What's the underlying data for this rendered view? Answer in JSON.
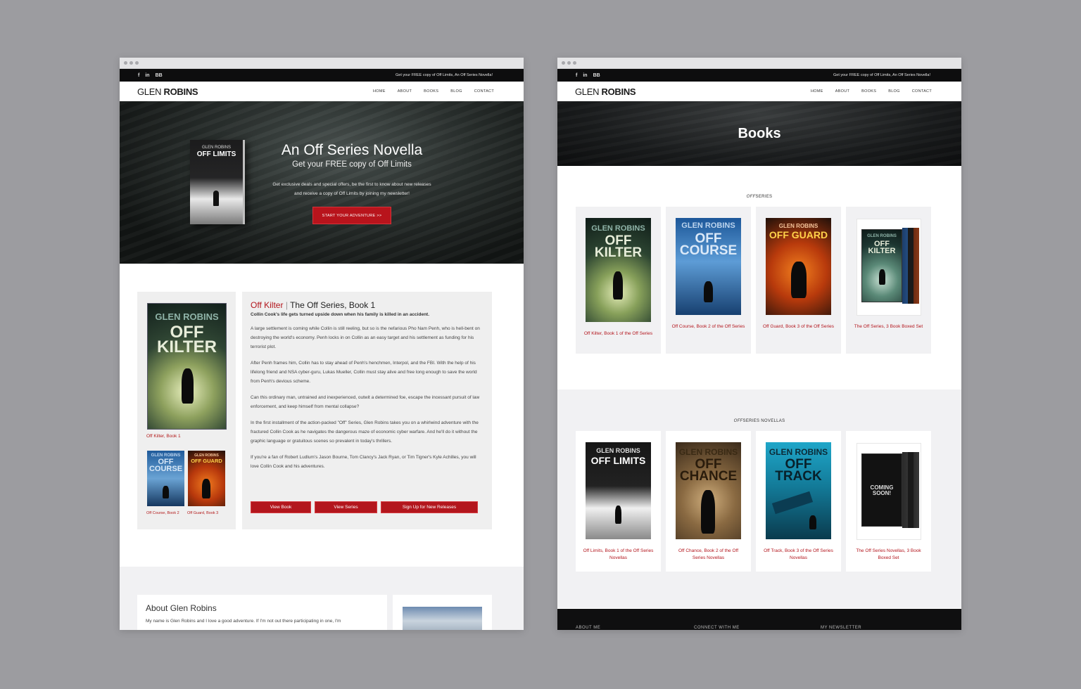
{
  "left_window": {
    "topbar": {
      "message": "Get your FREE copy of Off Limits, An Off Series Novella!"
    },
    "logo": {
      "first": "GLEN",
      "last": "ROBINS"
    },
    "nav": [
      "HOME",
      "ABOUT",
      "BOOKS",
      "BLOG",
      "CONTACT"
    ],
    "hero": {
      "book_author": "GLEN ROBINS",
      "book_title": "OFF LIMITS",
      "title": "An Off Series Novella",
      "subtitle": "Get your FREE copy of Off Limits",
      "body_line1": "Get exclusive deals and special offers, be the first to know about new releases",
      "body_line2": "and receive a copy of Off Limits by joining my newsletter!",
      "button": "START YOUR ADVENTURE >>"
    },
    "feature": {
      "cover_author": "GLEN ROBINS",
      "cover_title": "OFF KILTER",
      "cover_link": "Off Kilter, Book 1",
      "small1_author": "GLEN ROBINS",
      "small1_title": "OFF COURSE",
      "small2_author": "GLEN ROBINS",
      "small2_title": "OFF GUARD",
      "small_link1": "Off Course, Book 2",
      "small_link2": "Off Guard, Book 3",
      "title_red": "Off Kilter",
      "title_sep": "|",
      "title_rest": "The Off Series, Book 1",
      "tagline": "Collin Cook's life gets turned upside down when his family is killed in an accident.",
      "paragraphs": [
        "A large settlement is coming while Collin is still reeling, but so is the nefarious Pho Nam Penh, who is hell-bent on destroying the world's economy. Penh locks in on Collin as an easy target and his settlement as funding for his terrorist plot.",
        "After Penh frames him, Collin has to stay ahead of Penh's henchmen, Interpol, and the FBI. With the help of his lifelong friend and NSA cyber-guru, Lukas Mueller, Collin must stay alive and free long enough to save the world from Penh's devious scheme.",
        "Can this ordinary man, untrained and inexperienced, outwit a determined foe, escape the incessant pursuit of law enforcement, and keep himself from mental collapse?",
        "In the first installment of the action-packed \"Off\" Series, Glen Robins takes you on a whirlwind adventure with the fractured Collin Cook as he navigates the dangerous maze of economic cyber warfare. And he'll do it without the graphic language or gratuitous scenes so prevalent in today's thrillers.",
        "If you're a fan of Robert Ludlum's Jason Bourne, Tom Clancy's Jack Ryan, or Tim Tigner's Kyle Achilles, you will love Collin Cook and his adventures."
      ],
      "buttons": [
        "View Book",
        "View Series",
        "Sign Up for New Releases"
      ]
    },
    "about": {
      "title": "About Glen Robins",
      "text": "My name is Glen Robins and I love a good adventure. If I'm not out there participating in one, I'm"
    }
  },
  "right_window": {
    "topbar": {
      "message": "Get your FREE copy of Off Limits, An Off Series Novella!"
    },
    "logo": {
      "first": "GLEN",
      "last": "ROBINS"
    },
    "nav": [
      "HOME",
      "ABOUT",
      "BOOKS",
      "BLOG",
      "CONTACT"
    ],
    "page_title": "Books",
    "series": {
      "label_italic": "OFF",
      "label_rest": "SERIES",
      "books": [
        {
          "author": "GLEN ROBINS",
          "title": "OFF KILTER",
          "caption": "Off Kilter, Book 1 of the Off Series"
        },
        {
          "author": "GLEN ROBINS",
          "title": "OFF COURSE",
          "caption": "Off Course, Book 2 of the Off Series"
        },
        {
          "author": "GLEN ROBINS",
          "title": "OFF GUARD",
          "caption": "Off Guard, Book 3 of the Off Series"
        },
        {
          "author": "GLEN ROBINS",
          "title": "OFF KILTER",
          "caption": "The Off Series, 3 Book Boxed Set"
        }
      ]
    },
    "novellas": {
      "label_italic": "OFF",
      "label_rest": "SERIES NOVELLAS",
      "books": [
        {
          "author": "GLEN ROBINS",
          "title": "OFF LIMITS",
          "caption": "Off Limits, Book 1 of the Off Series Novellas"
        },
        {
          "author": "GLEN ROBINS",
          "title": "OFF CHANCE",
          "caption": "Off Chance, Book 2 of the Off Series Novellas"
        },
        {
          "author": "GLEN ROBINS",
          "title": "OFF TRACK",
          "caption": "Off Track, Book 3 of the Off Series Novellas"
        },
        {
          "author": "COMING SOON!",
          "title": "",
          "caption": "The Off Series Novellas, 3 Book Boxed Set"
        }
      ]
    },
    "footer": [
      "ABOUT ME",
      "CONNECT WITH ME",
      "MY NEWSLETTER"
    ]
  },
  "colors": {
    "accent": "#b3161d",
    "dark": "#0d0d0e",
    "background": "#9c9ca0"
  }
}
